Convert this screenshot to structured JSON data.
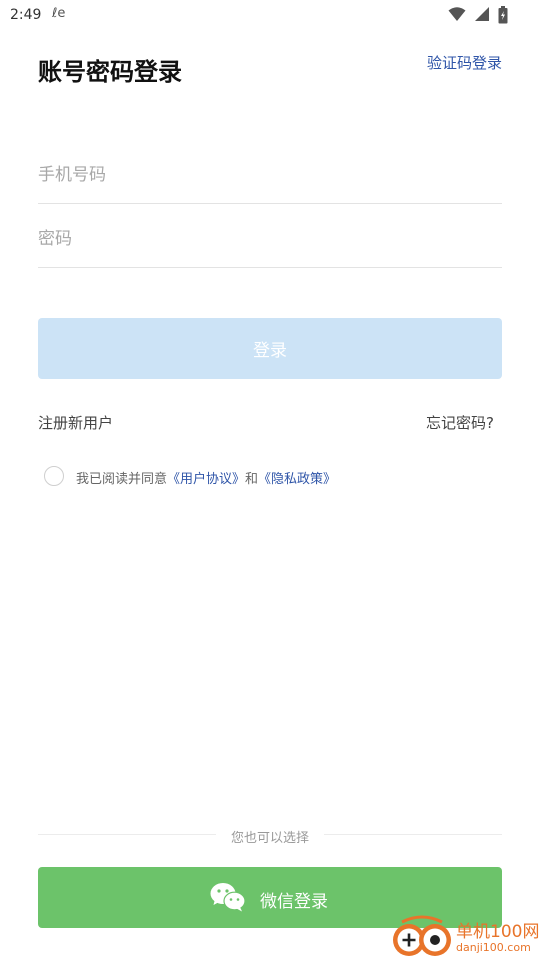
{
  "status_bar": {
    "time": "2:49",
    "carrier_glyph": "ℓe",
    "icons": [
      "wifi-icon",
      "signal-icon",
      "battery-icon"
    ]
  },
  "header": {
    "title": "账号密码登录",
    "alt_login_link": "验证码登录"
  },
  "form": {
    "phone_placeholder": "手机号码",
    "password_placeholder": "密码",
    "login_button": "登录"
  },
  "links": {
    "register": "注册新用户",
    "forgot_password": "忘记密码?"
  },
  "agreement": {
    "prefix": "我已阅读并同意",
    "user_agreement": "《用户协议》",
    "conjunction": "和",
    "privacy_policy": "《隐私政策》"
  },
  "alternative": {
    "divider_text": "您也可以选择",
    "wechat_button": "微信登录"
  },
  "watermark": {
    "name": "单机100网",
    "domain": "danji100.com"
  },
  "colors": {
    "link_blue": "#2f55a8",
    "login_disabled": "#cce3f6",
    "wechat_green": "#6cc36a",
    "watermark_orange": "#e8742a"
  }
}
